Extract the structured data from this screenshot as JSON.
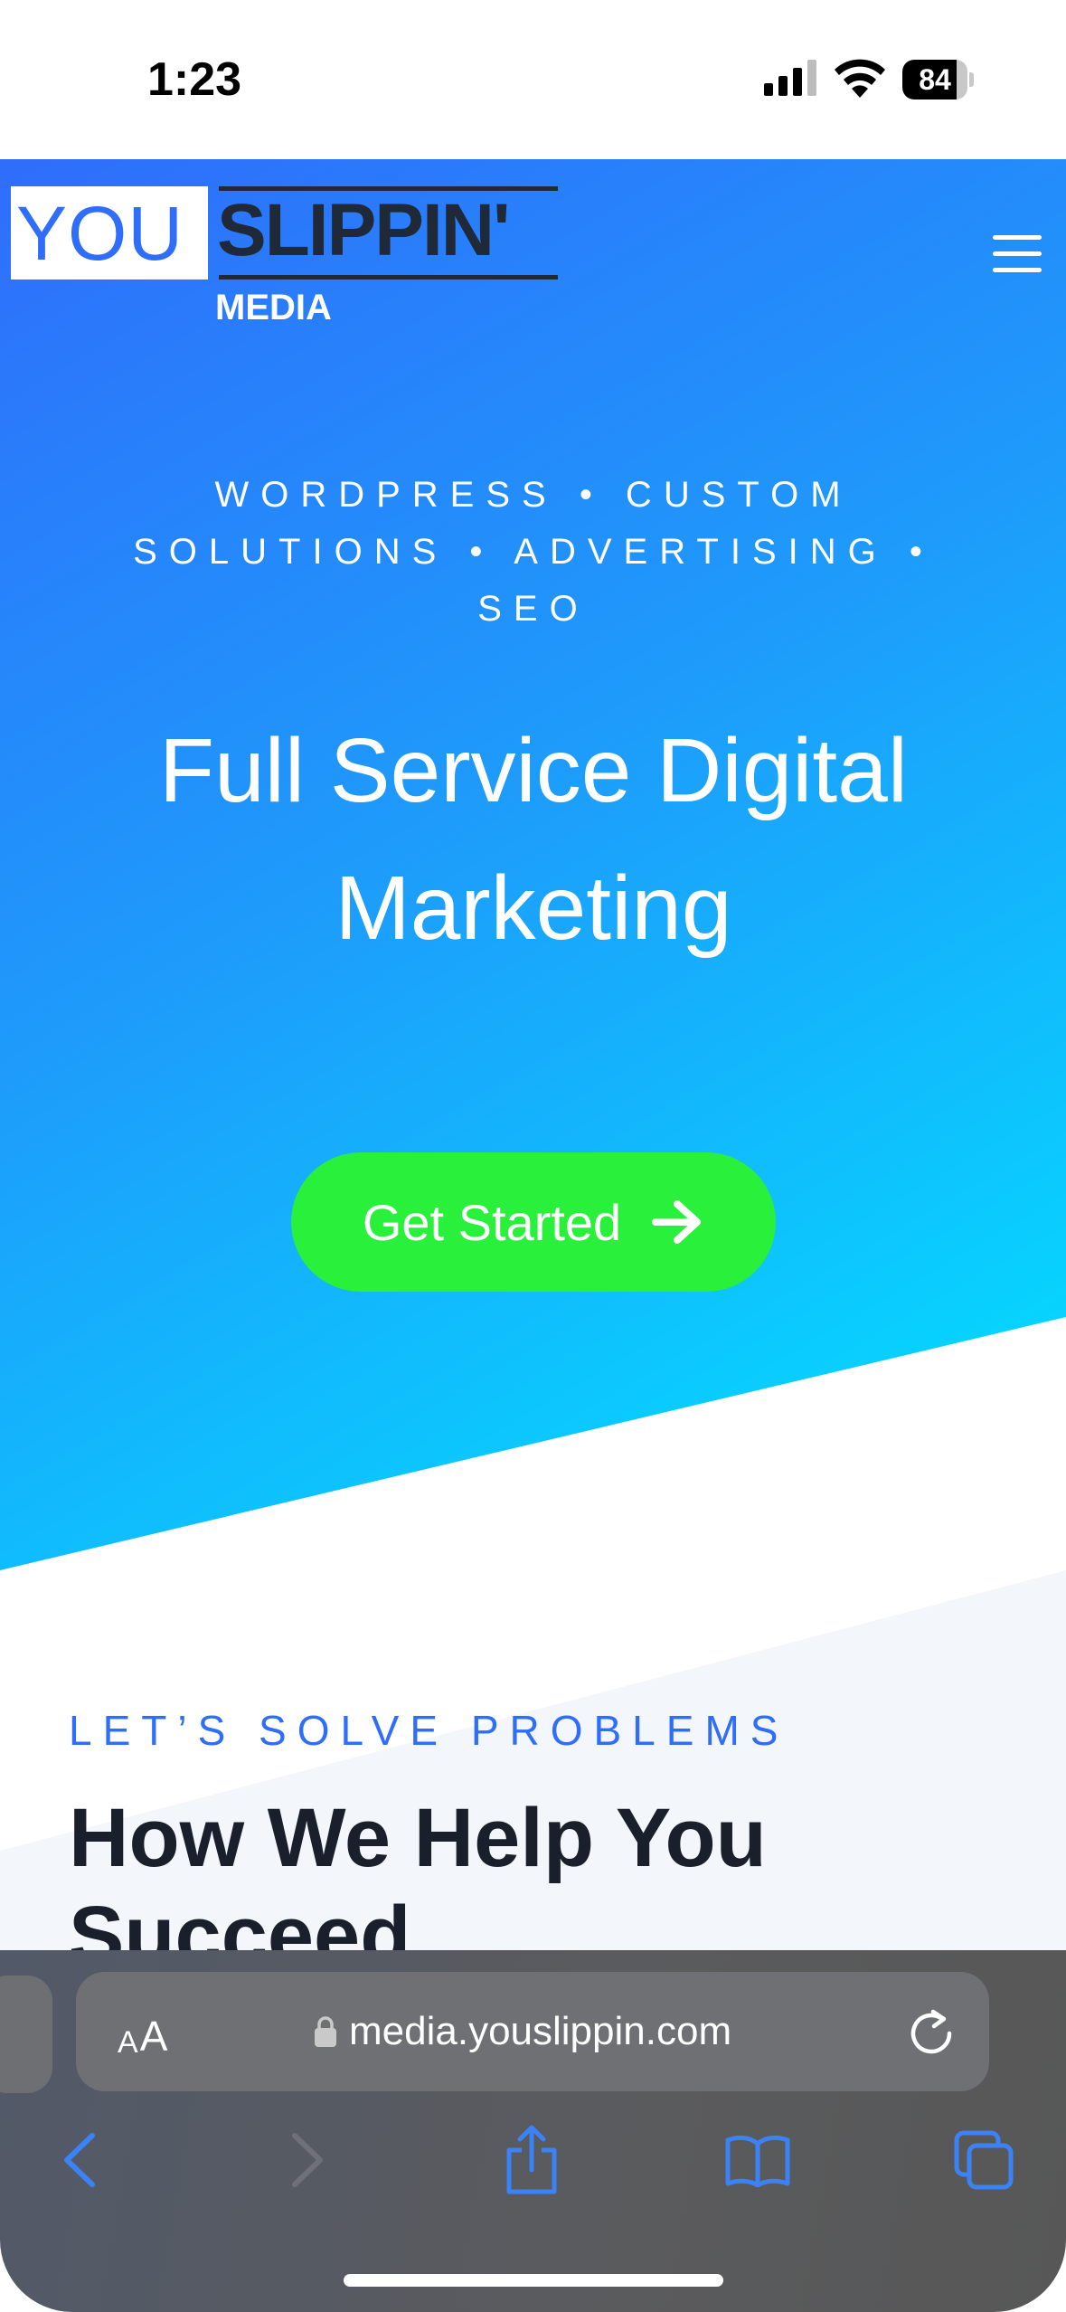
{
  "status_bar": {
    "time": "1:23",
    "battery_percent": "84",
    "battery_level": 0.84
  },
  "site": {
    "logo": {
      "you": "YOU",
      "slippin": "SLIPPIN'",
      "media": "MEDIA"
    },
    "menu_icon": "hamburger-menu-icon",
    "hero": {
      "tagline": "WORDPRESS • CUSTOM SOLUTIONS • ADVERTISING • SEO",
      "title": "Full Service Digital Marketing",
      "cta_label": "Get Started",
      "cta_icon": "arrow-right-icon",
      "gradient_start": "#2f6dfb",
      "gradient_end": "#00e4ff",
      "cta_color": "#29f03a"
    },
    "section": {
      "eyebrow": "LET’S SOLVE PROBLEMS",
      "title": "How We Help You Succeed..."
    }
  },
  "browser": {
    "text_size_small": "A",
    "text_size_big": "A",
    "url": "media.youslippin.com",
    "toolbar": {
      "back_icon": "chevron-left-icon",
      "forward_icon": "chevron-right-icon",
      "share_icon": "share-icon",
      "bookmarks_icon": "book-icon",
      "tabs_icon": "tabs-icon"
    },
    "accent": "#3b82f6"
  }
}
